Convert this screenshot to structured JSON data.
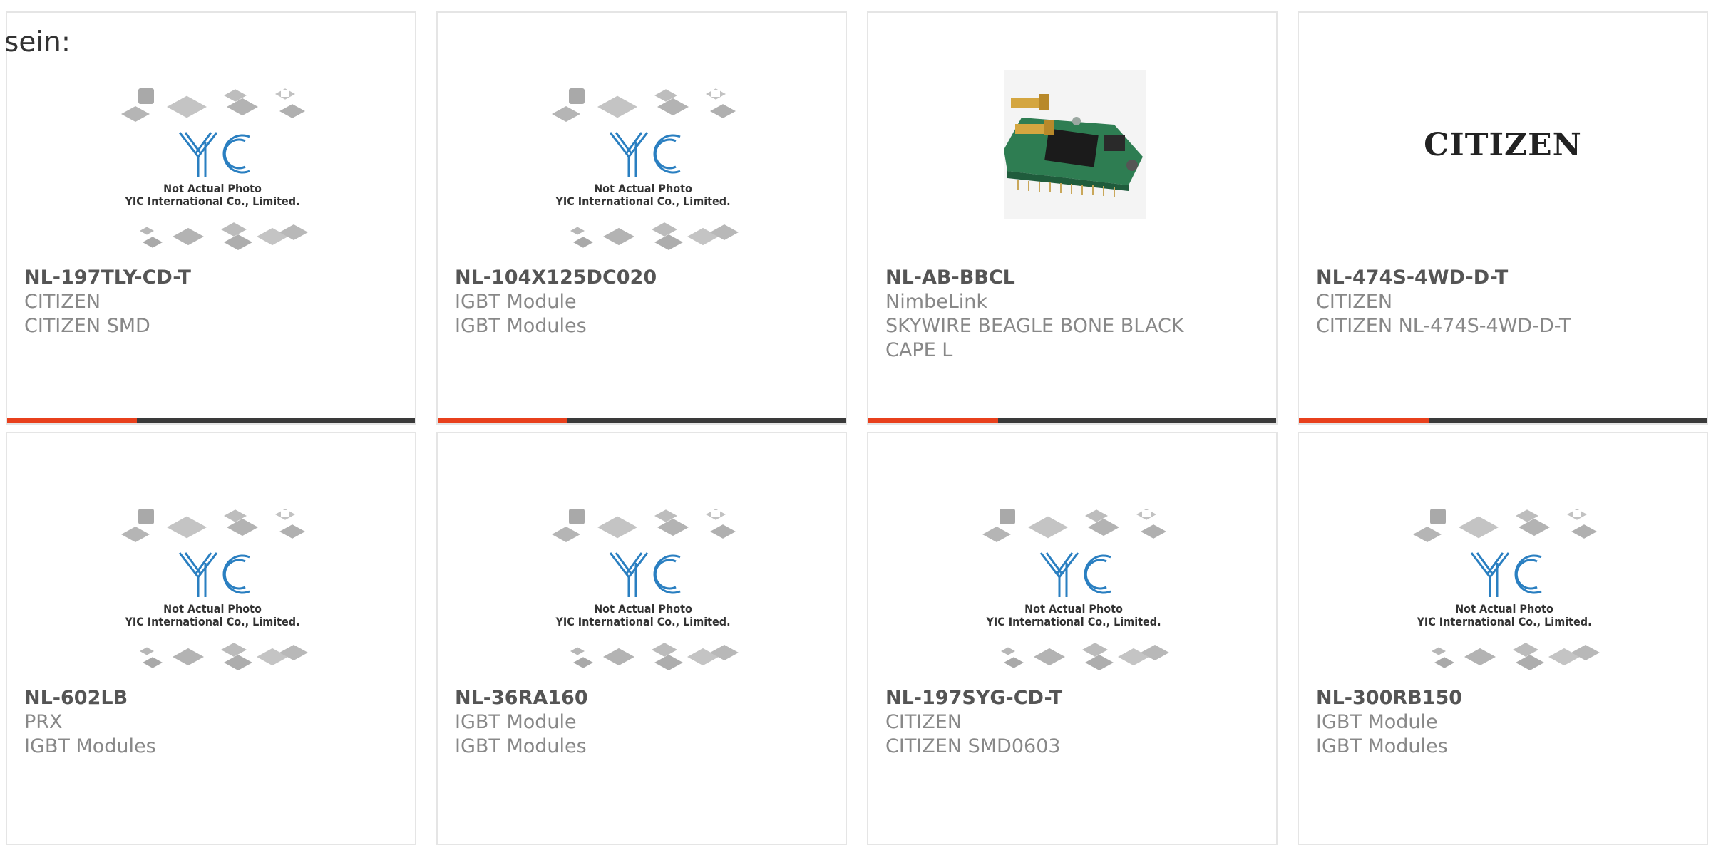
{
  "intro": "sein:",
  "accent_color": "#e8401c",
  "bar_color": "#3a3a3a",
  "placeholder": {
    "line1": "Not Actual Photo",
    "line2": "YIC International Co., Limited.",
    "logo_text": "YIC"
  },
  "products": [
    {
      "part": "NL-197TLY-CD-T",
      "maker": "CITIZEN",
      "desc": "CITIZEN SMD",
      "image": "placeholder"
    },
    {
      "part": "NL-104X125DC020",
      "maker": "IGBT Module",
      "desc": "IGBT Modules",
      "image": "placeholder"
    },
    {
      "part": "NL-AB-BBCL",
      "maker": "NimbeLink",
      "desc": "SKYWIRE BEAGLE BONE BLACK CAPE L",
      "image": "board-photo"
    },
    {
      "part": "NL-474S-4WD-D-T",
      "maker": "CITIZEN",
      "desc": "CITIZEN NL-474S-4WD-D-T",
      "image": "citizen-logo",
      "logo_text": "CITIZEN"
    },
    {
      "part": "NL-602LB",
      "maker": "PRX",
      "desc": "IGBT Modules",
      "image": "placeholder"
    },
    {
      "part": "NL-36RA160",
      "maker": "IGBT Module",
      "desc": "IGBT Modules",
      "image": "placeholder"
    },
    {
      "part": "NL-197SYG-CD-T",
      "maker": "CITIZEN",
      "desc": "CITIZEN SMD0603",
      "image": "placeholder"
    },
    {
      "part": "NL-300RB150",
      "maker": "IGBT Module",
      "desc": "IGBT Modules",
      "image": "placeholder"
    }
  ]
}
